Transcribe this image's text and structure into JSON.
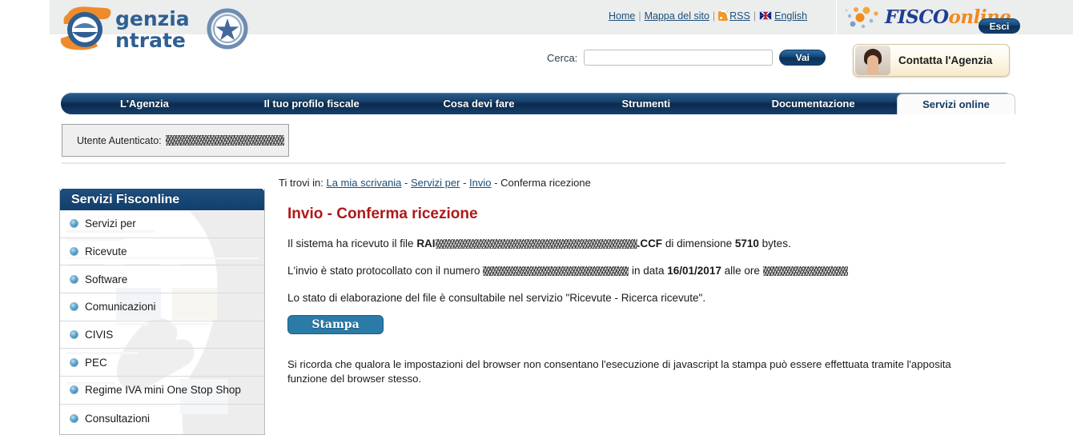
{
  "header": {
    "logo_alt": "Agenzia Entrate",
    "logo_word_1": "genzia",
    "logo_word_2": "ntrate",
    "toplinks": [
      {
        "label": "Home",
        "icon": ""
      },
      {
        "label": "Mappa del sito",
        "icon": ""
      },
      {
        "label": "RSS",
        "icon": "rss-icon"
      },
      {
        "label": "English",
        "icon": "uk-flag-icon"
      }
    ],
    "search": {
      "label": "Cerca:",
      "value": "",
      "placeholder": "",
      "button": "Vai"
    },
    "fisconline": {
      "brand_1": "FISCO",
      "brand_2": "online",
      "logout": "Esci",
      "contact": "Contatta l'Agenzia"
    }
  },
  "mainnav": {
    "items": [
      {
        "label": "L'Agenzia",
        "active": false
      },
      {
        "label": "Il tuo profilo fiscale",
        "active": false
      },
      {
        "label": "Cosa devi fare",
        "active": false
      },
      {
        "label": "Strumenti",
        "active": false
      },
      {
        "label": "Documentazione",
        "active": false
      },
      {
        "label": "Servizi online",
        "active": true
      }
    ]
  },
  "auth": {
    "label": "Utente Autenticato:",
    "username": "[redacted]"
  },
  "sidebar": {
    "title": "Servizi Fisconline",
    "items": [
      {
        "label": "Servizi per"
      },
      {
        "label": "Ricevute"
      },
      {
        "label": "Software"
      },
      {
        "label": "Comunicazioni"
      },
      {
        "label": "CIVIS"
      },
      {
        "label": "PEC"
      },
      {
        "label": "Regime IVA mini One Stop Shop"
      },
      {
        "label": "Consultazioni"
      }
    ]
  },
  "content": {
    "breadcrumb": {
      "prefix": "Ti trovi in:",
      "links": [
        "La mia scrivania",
        "Servizi per",
        "Invio"
      ],
      "current": "Conferma ricezione",
      "separator": "-"
    },
    "title": "Invio - Conferma ricezione",
    "p1": {
      "t1": "Il sistema ha ricevuto il file ",
      "b1": "RAI",
      "redacted": "[redacted filename]",
      "b2": ".CCF",
      "t2": " di dimensione ",
      "b3": "5710",
      "t3": " bytes."
    },
    "p2": {
      "t1": "L'invio è stato protocollato con il numero ",
      "redacted1": "[redacted protocol number]",
      "t2": " in data ",
      "b1": "16/01/2017",
      "t3": " alle ore ",
      "redacted2": "[redacted time]"
    },
    "p3": "Lo stato di elaborazione del file è consultabile nel servizio \"Ricevute - Ricerca ricevute\".",
    "print_button": "Stampa",
    "p4": "Si ricorda che qualora le impostazioni del browser non consentano l'esecuzione di javascript la stampa può essere effettuata tramite l'apposita funzione del browser stesso."
  },
  "colors": {
    "nav_blue": "#14406c",
    "title_red": "#b01818",
    "link_blue": "#1a4f7a",
    "button_blue": "#2a7ba8",
    "header_grey": "#eceded",
    "logo_orange": "#f08b1d"
  }
}
